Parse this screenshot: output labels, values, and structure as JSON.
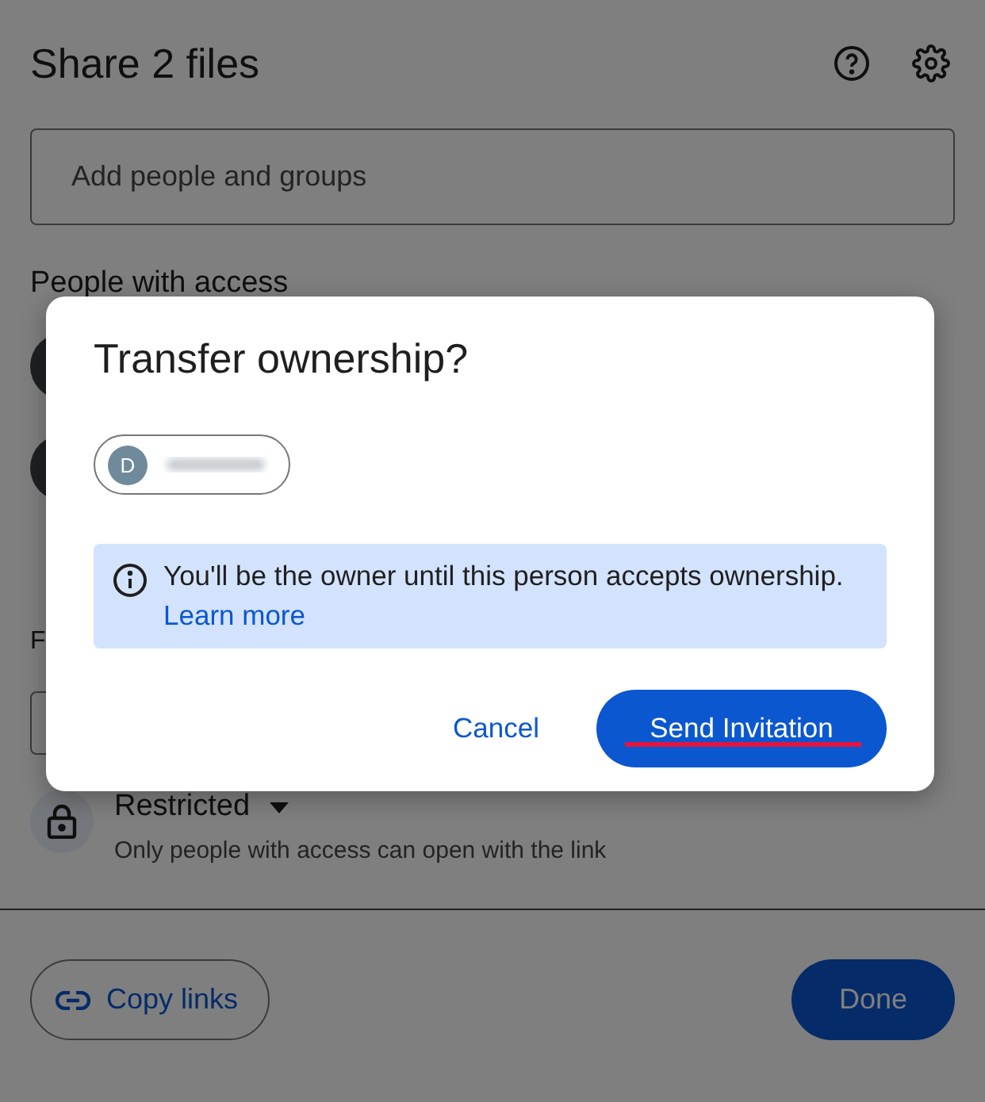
{
  "share_dialog": {
    "title": "Share 2 files",
    "search": {
      "placeholder": "Add people and groups"
    },
    "people_heading": "People with access",
    "people": [
      {
        "kind": "avatar"
      },
      {
        "kind": "avatar"
      }
    ],
    "general_row_text": "F",
    "general_access": {
      "label": "Restricted",
      "description": "Only people with access can open with the link"
    },
    "copy_button": "Copy links",
    "done_button": "Done"
  },
  "modal": {
    "title": "Transfer ownership?",
    "chip": {
      "initial": "D"
    },
    "info": {
      "text": "You'll be the owner until this person accepts ownership.",
      "link": "Learn more"
    },
    "buttons": [
      {
        "label": "Cancel",
        "kind": "text",
        "underlined": false
      },
      {
        "label": "Send Invitation",
        "kind": "filled",
        "underlined": true
      }
    ]
  }
}
